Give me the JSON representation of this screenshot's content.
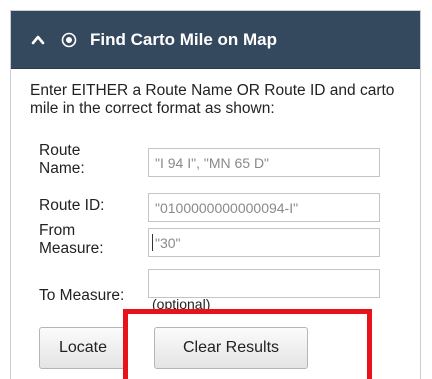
{
  "header": {
    "title": "Find Carto Mile on Map",
    "chevron_icon": "chevron-up-icon",
    "target_icon": "target-icon",
    "background": "#34495e"
  },
  "instructions": "Enter EITHER a Route Name OR Route ID and carto mile in the correct format as shown:",
  "form": {
    "route_name": {
      "label": "Route Name:",
      "value": "",
      "placeholder": "\"I 94 I\", \"MN 65 D\""
    },
    "route_id": {
      "label": "Route ID:",
      "value": "",
      "placeholder": "\"0100000000000094-I\""
    },
    "from_measure": {
      "label": "From Measure:",
      "value": "",
      "placeholder": "\"30\""
    },
    "to_measure": {
      "label": "To Measure:",
      "value": "",
      "hint": "(optional)"
    }
  },
  "buttons": {
    "locate": "Locate",
    "clear": "Clear Results"
  },
  "colors": {
    "highlight": "#e8121a"
  }
}
